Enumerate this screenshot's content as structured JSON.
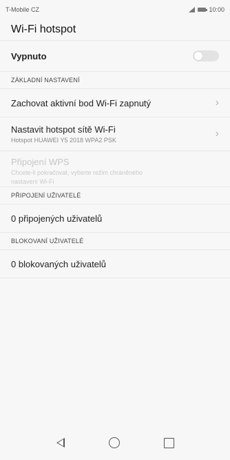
{
  "status": {
    "carrier": "T-Mobile CZ",
    "time": "10:00"
  },
  "title": "Wi-Fi hotspot",
  "toggle": {
    "label": "Vypnuto",
    "state": "off"
  },
  "sections": {
    "basic": "ZÁKLADNÍ NASTAVENÍ",
    "connected": "PŘIPOJENÍ UŽIVATELÉ",
    "blocked": "BLOKOVANÍ UŽIVATELÉ"
  },
  "items": {
    "keep_on": "Zachovat aktivní bod Wi-Fi zapnutý",
    "configure": {
      "title": "Nastavit hotspot sítě Wi-Fi",
      "subtitle": "Hotspot HUAWEI Y5 2018 WPA2 PSK"
    },
    "wps": {
      "title": "Připojení WPS",
      "subtitle_line1": "Chcete-li pokračovat, vyberte režim chráněného",
      "subtitle_line2": "nastavení Wi-Fi"
    },
    "connected_users": "0 připojených uživatelů",
    "blocked_users": "0 blokovaných uživatelů"
  },
  "icons": {
    "signal": "signal-icon",
    "battery": "battery-icon",
    "chevron": "chevron-right-icon",
    "back": "back-icon",
    "home": "home-icon",
    "recent": "recent-apps-icon"
  }
}
